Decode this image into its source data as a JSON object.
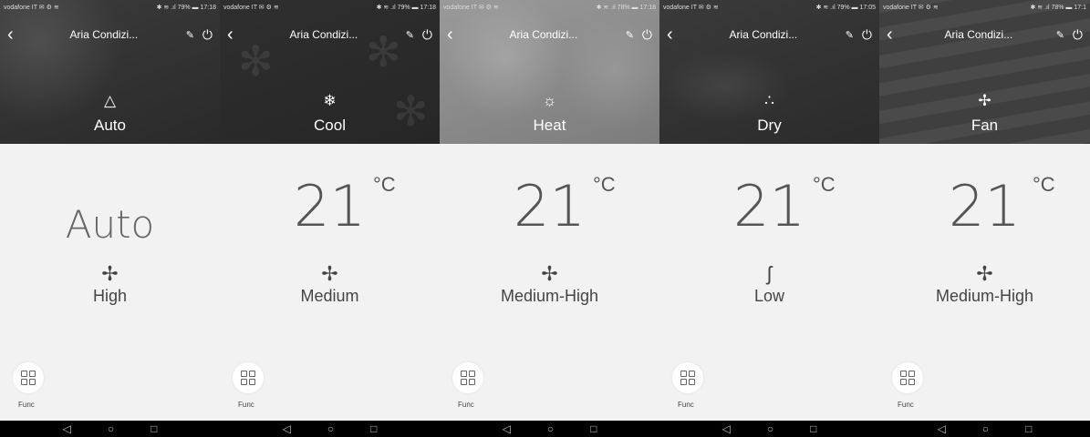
{
  "screens": [
    {
      "status_left": "vodafone IT ✉ ⚙ ≋",
      "status_right": "✱ ≋ .ıl 79% ▬ 17:18",
      "title": "Aria Condizi...",
      "mode_icon": "△",
      "mode_label": "Auto",
      "temperature": "Auto",
      "unit": "",
      "fan_icon": "✢",
      "fan_label": "High",
      "func_label": "Func"
    },
    {
      "status_left": "vodafone IT ✉ ⚙ ≋",
      "status_right": "✱ ≋ .ıl 79% ▬ 17:18",
      "title": "Aria Condizi...",
      "mode_icon": "❄",
      "mode_label": "Cool",
      "temperature": "21",
      "unit": "°C",
      "fan_icon": "✢",
      "fan_label": "Medium",
      "func_label": "Func"
    },
    {
      "status_left": "vodafone IT ✉ ⚙ ≋",
      "status_right": "✱ ≋ .ıl 78% ▬ 17:18",
      "title": "Aria Condizi...",
      "mode_icon": "☼",
      "mode_label": "Heat",
      "temperature": "21",
      "unit": "°C",
      "fan_icon": "✢",
      "fan_label": "Medium-High",
      "func_label": "Func"
    },
    {
      "status_left": "vodafone IT ✉ ⚙ ≋",
      "status_right": "✱ ≋ .ıl 79% ▬ 17:05",
      "title": "Aria Condizi...",
      "mode_icon": "∴",
      "mode_label": "Dry",
      "temperature": "21",
      "unit": "°C",
      "fan_icon": "ʃ",
      "fan_label": "Low",
      "func_label": "Func"
    },
    {
      "status_left": "vodafone IT ✉ ⚙ ≋",
      "status_right": "✱ ≋ .ıl 78% ▬ 17:1",
      "title": "Aria Condizi...",
      "mode_icon": "✢",
      "mode_label": "Fan",
      "temperature": "21",
      "unit": "°C",
      "fan_icon": "✢",
      "fan_label": "Medium-High",
      "func_label": "Func"
    }
  ],
  "nav": {
    "back": "◁",
    "home": "○",
    "recent": "□"
  },
  "icons": {
    "back": "chevron-left-icon",
    "edit": "pencil-icon",
    "power": "power-icon",
    "func": "grid-icon"
  }
}
